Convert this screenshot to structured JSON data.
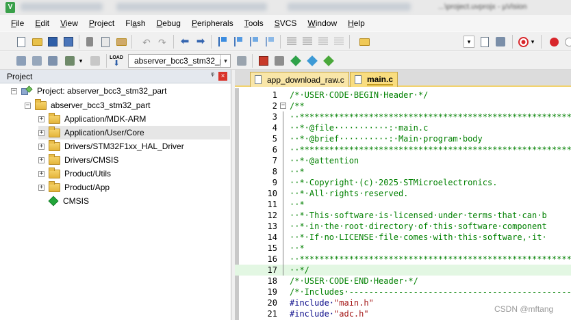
{
  "titlebar": {
    "app_icon": "V",
    "title_partial": "...\\project.uvprojx - µVision"
  },
  "menu": [
    {
      "label": "File",
      "key": "F",
      "rest": "ile"
    },
    {
      "label": "Edit",
      "key": "E",
      "rest": "dit"
    },
    {
      "label": "View",
      "key": "V",
      "rest": "iew"
    },
    {
      "label": "Project",
      "key": "P",
      "rest": "roject"
    },
    {
      "label": "Flash",
      "key": "",
      "pre": "Fl",
      "key2": "a",
      "rest": "sh"
    },
    {
      "label": "Debug",
      "key": "D",
      "rest": "ebug"
    },
    {
      "label": "Peripherals",
      "key": "P",
      "rest": "eripherals"
    },
    {
      "label": "Tools",
      "key": "T",
      "rest": "ools"
    },
    {
      "label": "SVCS",
      "key": "S",
      "rest": "VCS"
    },
    {
      "label": "Window",
      "key": "W",
      "rest": "indow"
    },
    {
      "label": "Help",
      "key": "H",
      "rest": "elp"
    }
  ],
  "toolbar2": {
    "target": "abserver_bcc3_stm32_part",
    "load_label": "LOAD"
  },
  "project_panel": {
    "title": "Project",
    "pin": "ᵠ",
    "close": "×",
    "root": "Project: abserver_bcc3_stm32_part",
    "target": "abserver_bcc3_stm32_part",
    "groups": [
      {
        "label": "Application/MDK-ARM",
        "selected": false
      },
      {
        "label": "Application/User/Core",
        "selected": true
      },
      {
        "label": "Drivers/STM32F1xx_HAL_Driver",
        "selected": false
      },
      {
        "label": "Drivers/CMSIS",
        "selected": false
      },
      {
        "label": "Product/Utils",
        "selected": false
      },
      {
        "label": "Product/App",
        "selected": false
      }
    ],
    "component": "CMSIS"
  },
  "tabs": [
    {
      "label": "app_download_raw.c",
      "active": false
    },
    {
      "label": "main.c",
      "active": true
    }
  ],
  "code_lines": [
    {
      "n": "1",
      "text": "/*·USER·CODE·BEGIN·Header·*/",
      "fold": "",
      "type": "comment"
    },
    {
      "n": "2",
      "text": "/**",
      "fold": "−",
      "type": "comment"
    },
    {
      "n": "3",
      "text": "··*******************************************************************",
      "fold": "|",
      "type": "comment"
    },
    {
      "n": "4",
      "text": "··*·@file···········:·main.c",
      "fold": "|",
      "type": "comment"
    },
    {
      "n": "5",
      "text": "··*·@brief··········:·Main·program·body",
      "fold": "|",
      "type": "comment"
    },
    {
      "n": "6",
      "text": "··*******************************************************************",
      "fold": "|",
      "type": "comment"
    },
    {
      "n": "7",
      "text": "··*·@attention",
      "fold": "|",
      "type": "comment"
    },
    {
      "n": "8",
      "text": "··*",
      "fold": "|",
      "type": "comment"
    },
    {
      "n": "9",
      "text": "··*·Copyright·(c)·2025·STMicroelectronics.",
      "fold": "|",
      "type": "comment"
    },
    {
      "n": "10",
      "text": "··*·All·rights·reserved.",
      "fold": "|",
      "type": "comment"
    },
    {
      "n": "11",
      "text": "··*",
      "fold": "|",
      "type": "comment"
    },
    {
      "n": "12",
      "text": "··*·This·software·is·licensed·under·terms·that·can·b",
      "fold": "|",
      "type": "comment"
    },
    {
      "n": "13",
      "text": "··*·in·the·root·directory·of·this·software·component",
      "fold": "|",
      "type": "comment"
    },
    {
      "n": "14",
      "text": "··*·If·no·LICENSE·file·comes·with·this·software,·it·",
      "fold": "|",
      "type": "comment"
    },
    {
      "n": "15",
      "text": "··*",
      "fold": "|",
      "type": "comment"
    },
    {
      "n": "16",
      "text": "··*******************************************************************",
      "fold": "|",
      "type": "comment"
    },
    {
      "n": "17",
      "text": "··*/",
      "fold": "|",
      "type": "comment",
      "highlight": true
    },
    {
      "n": "18",
      "text": "/*·USER·CODE·END·Header·*/",
      "fold": "",
      "type": "comment"
    },
    {
      "n": "19",
      "text": "/*·Includes·-------------------------------------------------------",
      "fold": "",
      "type": "comment"
    },
    {
      "n": "20",
      "text": "#include·",
      "str": "\"main.h\"",
      "fold": "",
      "type": "include"
    },
    {
      "n": "21",
      "text": "#include·",
      "str": "\"adc.h\"",
      "fold": "",
      "type": "include"
    }
  ],
  "watermark": "CSDN @mftang"
}
